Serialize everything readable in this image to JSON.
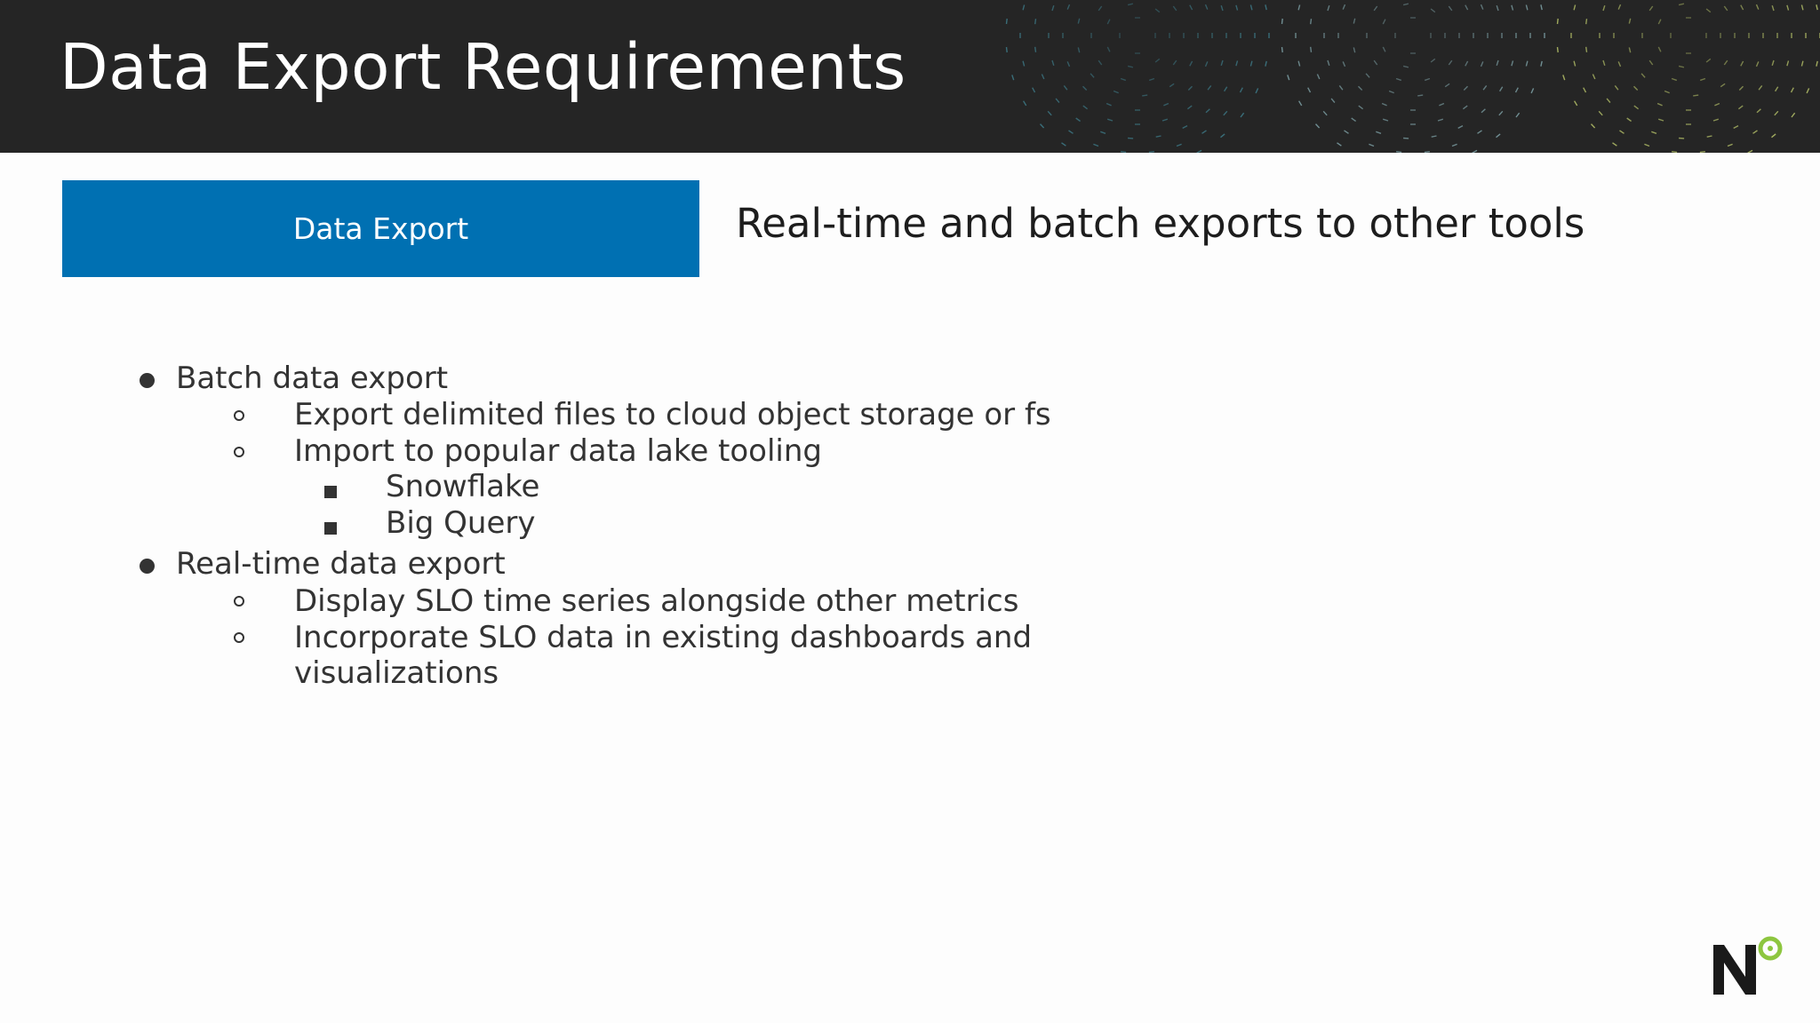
{
  "slide": {
    "title": "Data Export Requirements",
    "category_label": "Data Export",
    "subtitle": "Real-time and batch exports to other tools"
  },
  "colors": {
    "header_bg": "#252525",
    "category_bg": "#0070b2",
    "logo_accent": "#8dc63f"
  },
  "bullets": [
    {
      "text": "Batch data export",
      "children": [
        {
          "text": "Export delimited files to cloud object storage or fs"
        },
        {
          "text": "Import to popular data lake tooling",
          "children": [
            {
              "text": "Snowflake"
            },
            {
              "text": "Big Query"
            }
          ]
        }
      ]
    },
    {
      "text": "Real-time data export",
      "children": [
        {
          "text": "Display SLO time series alongside other metrics"
        },
        {
          "text": "Incorporate SLO data in existing dashboards and",
          "continuation": "visualizations"
        }
      ]
    }
  ],
  "logo": {
    "letter": "N",
    "icon": "nobl9-logo"
  }
}
